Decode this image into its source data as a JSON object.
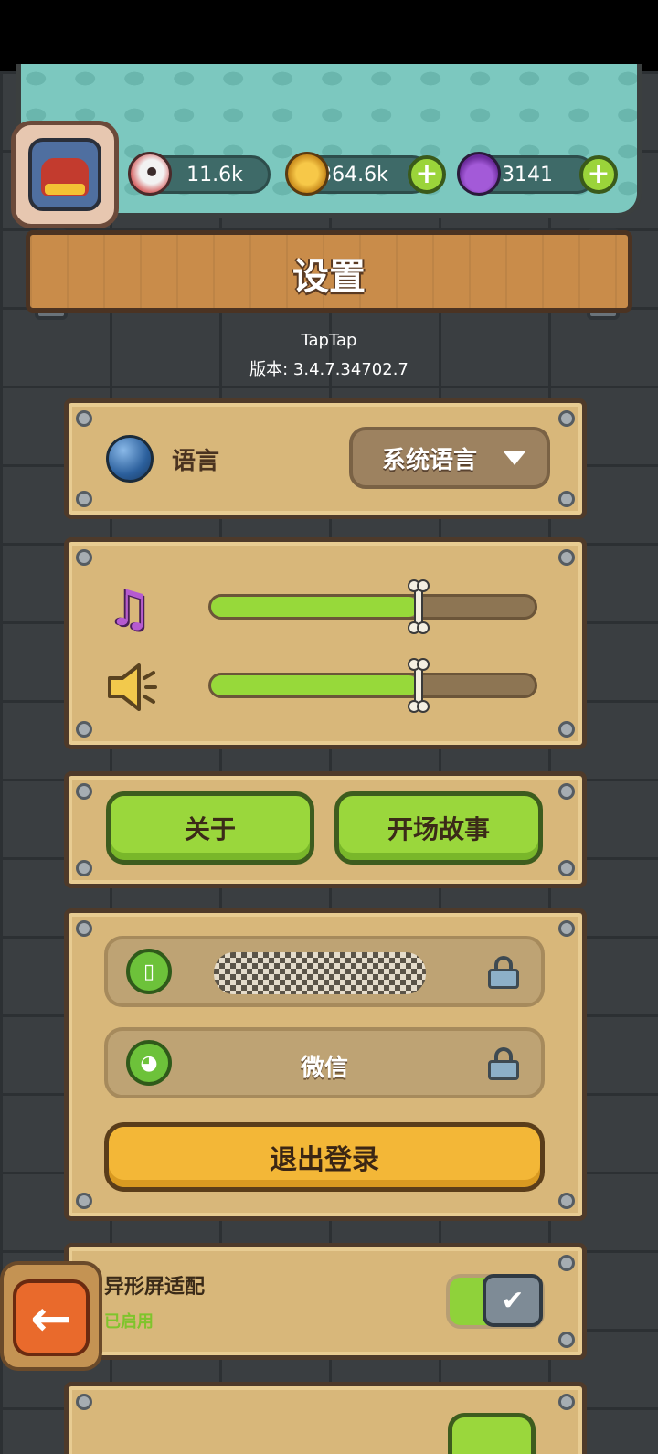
{
  "header": {
    "resources": [
      {
        "icon": "eyeball-icon",
        "value": "11.6k"
      },
      {
        "icon": "coin-icon",
        "value": "364.6k"
      },
      {
        "icon": "potion-icon",
        "value": "3141"
      }
    ],
    "plus_label": "+"
  },
  "page": {
    "title": "设置",
    "channel": "TapTap",
    "version": "版本: 3.4.7.34702.7"
  },
  "language": {
    "label": "语言",
    "selected": "系统语言"
  },
  "audio": {
    "music_level": 0.64,
    "sound_level": 0.64
  },
  "buttons": {
    "about": "关于",
    "opening_story": "开场故事"
  },
  "account": {
    "phone_label": "",
    "wechat_label": "微信",
    "logout": "退出登录"
  },
  "screen_adapt": {
    "label": "异形屏适配",
    "status": "已启用",
    "enabled": true
  },
  "nav": {
    "back_arrow": "←"
  },
  "colors": {
    "accent_green": "#9ad73c",
    "logout_yellow": "#f3b737",
    "status_green": "#8fd23a"
  }
}
